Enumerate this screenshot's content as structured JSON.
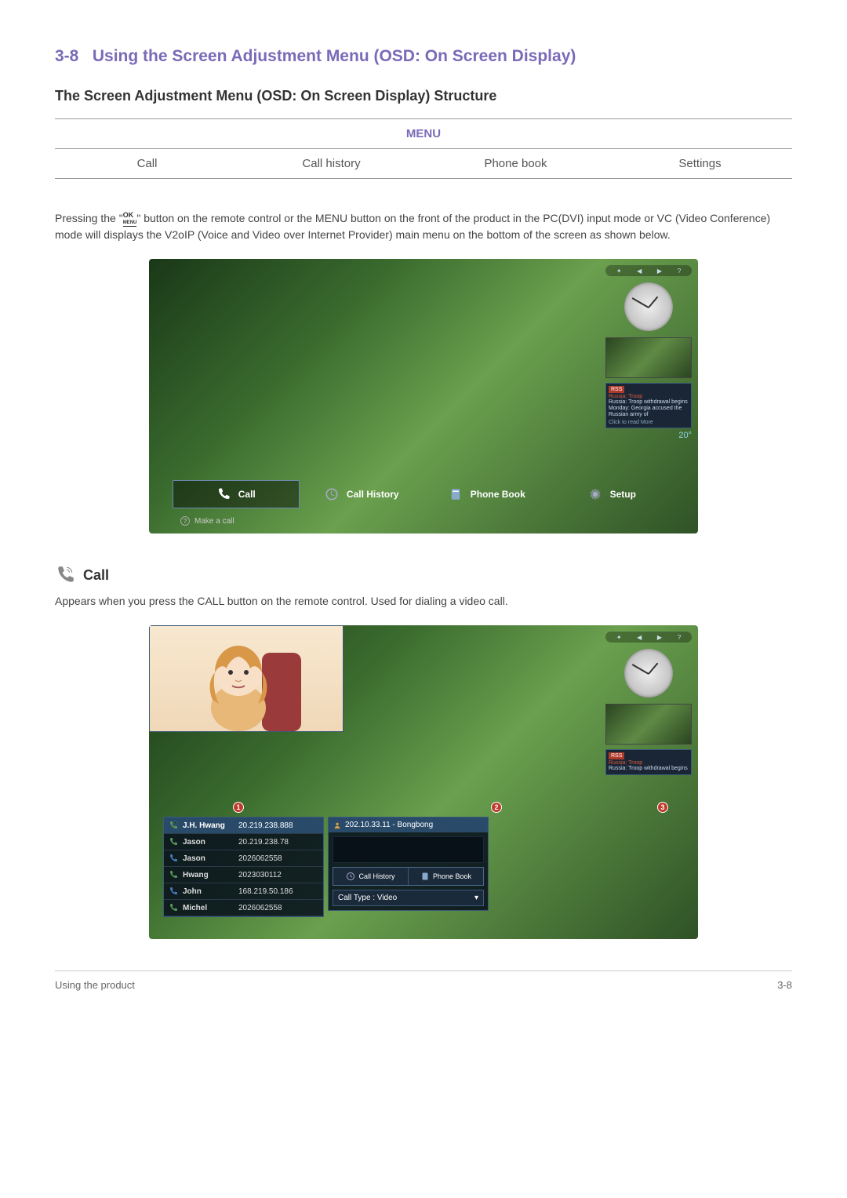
{
  "section": {
    "number": "3-8",
    "title": "Using the Screen Adjustment Menu (OSD: On Screen Display)"
  },
  "subsection_title": "The Screen Adjustment Menu (OSD: On Screen Display) Structure",
  "menu_table": {
    "header": "MENU",
    "cols": [
      "Call",
      "Call history",
      "Phone book",
      "Settings"
    ]
  },
  "body_text": {
    "pre": "Pressing the \"",
    "ok_top": "OK",
    "ok_bot": "MENU",
    "post": "\" button on the remote control or the MENU button on the front of the product in the PC(DVI) input mode or VC (Video Conference) mode will displays the V2oIP (Voice and Video over Internet Provider) main menu on the bottom of the screen as shown below."
  },
  "screenshot1": {
    "mini_icons": [
      "✦",
      "◀",
      "▶",
      "?"
    ],
    "rss_header": "RSS",
    "rss_title": "Russia: Troop",
    "rss_text": "Russia: Troop withdrawal begins Monday: Georgia accused the Russian army of",
    "rss_more": "Click to read More",
    "weather": "20°",
    "menu": [
      "Call",
      "Call History",
      "Phone Book",
      "Setup"
    ],
    "hint": "Make a call"
  },
  "call_section": {
    "heading": "Call",
    "desc": "Appears when you press the CALL button on the remote control. Used for dialing a video call."
  },
  "screenshot2": {
    "mini_icons": [
      "✦",
      "◀",
      "▶",
      "?"
    ],
    "rss_header": "RSS",
    "rss_title": "Russia: Troop",
    "rss_text": "Russia: Troop withdrawal begins",
    "badges": [
      "1",
      "2",
      "3"
    ],
    "contacts": [
      {
        "name": "J.H. Hwang",
        "ip": "20.219.238.888",
        "selected": true
      },
      {
        "name": "Jason",
        "ip": "20.219.238.78",
        "selected": false
      },
      {
        "name": "Jason",
        "ip": "2026062558",
        "selected": false
      },
      {
        "name": "Hwang",
        "ip": "2023030112",
        "selected": false
      },
      {
        "name": "John",
        "ip": "168.219.50.186",
        "selected": false
      },
      {
        "name": "Michel",
        "ip": "2026062558",
        "selected": false
      }
    ],
    "mid_header": "202.10.33.11 - Bongbong",
    "mid_btns": [
      "Call History",
      "Phone Book"
    ],
    "call_type": "Call Type : Video",
    "dropdown_arrow": "▾"
  },
  "footer": {
    "left": "Using the product",
    "right": "3-8"
  }
}
